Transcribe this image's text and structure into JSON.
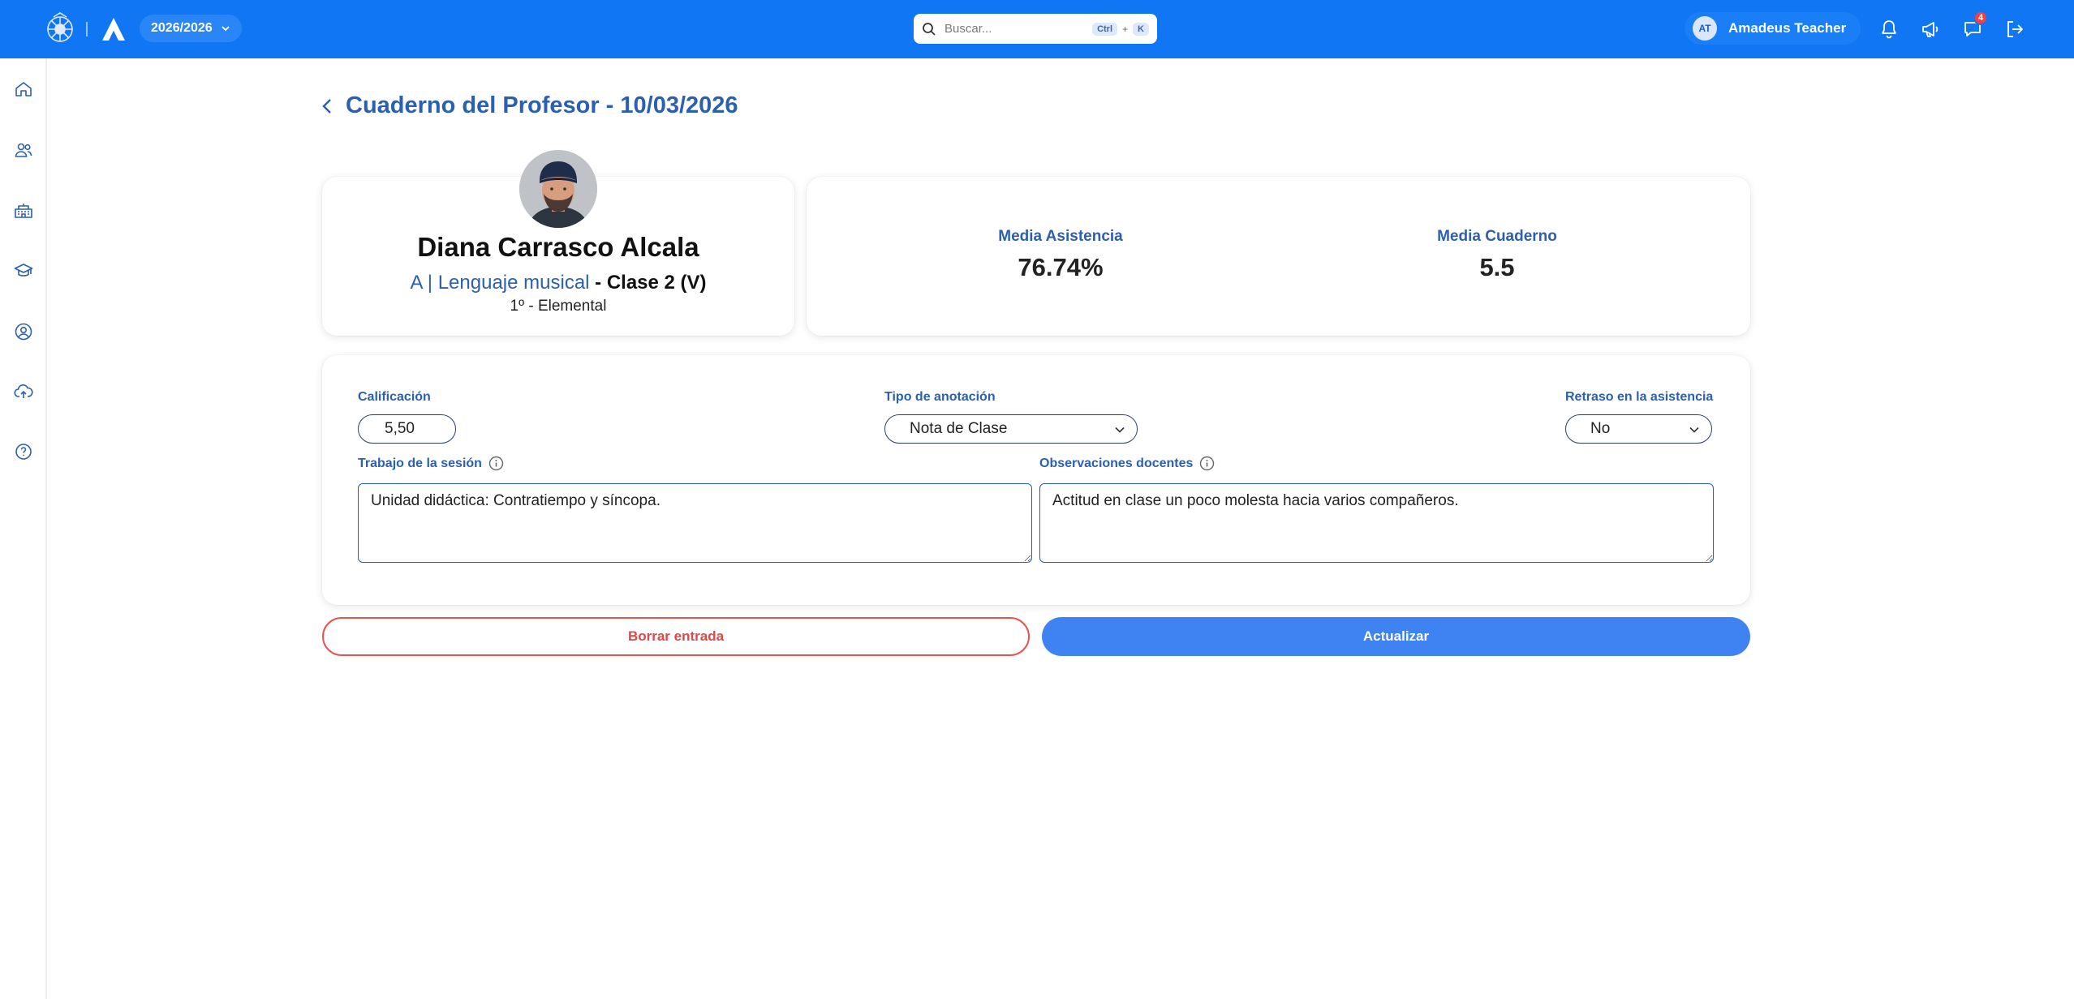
{
  "topbar": {
    "year": "2026/2026",
    "search": {
      "placeholder": "Buscar...",
      "kbd_ctrl": "Ctrl",
      "kbd_plus": "+",
      "kbd_k": "K"
    },
    "user": {
      "initials": "AT",
      "name": "Amadeus Teacher"
    },
    "messages_badge": "4",
    "icons": [
      "bell-icon",
      "megaphone-icon",
      "chat-icon",
      "logout-icon"
    ]
  },
  "sidebar": {
    "items": [
      {
        "icon": "home-icon"
      },
      {
        "icon": "users-icon"
      },
      {
        "icon": "school-icon"
      },
      {
        "icon": "graduation-cap-icon"
      },
      {
        "icon": "user-circle-icon"
      },
      {
        "icon": "cloud-upload-icon"
      },
      {
        "icon": "help-icon"
      }
    ]
  },
  "page": {
    "title": "Cuaderno del Profesor - 10/03/2026"
  },
  "student": {
    "name": "Diana Carrasco Alcala",
    "class_group": "A | Lenguaje musical",
    "class_session": " - Clase 2 (V)",
    "level": "1º - Elemental"
  },
  "stats": {
    "attendance_label": "Media Asistencia",
    "attendance_value": "76.74%",
    "notebook_label": "Media Cuaderno",
    "notebook_value": "5.5"
  },
  "form": {
    "grade_label": "Calificación",
    "grade_value": "5,50",
    "annotation_type_label": "Tipo de anotación",
    "annotation_type_value": "Nota de Clase",
    "delay_label": "Retraso en la asistencia",
    "delay_value": "No",
    "session_work_label": "Trabajo de la sesión",
    "session_work_value": "Unidad didáctica: Contratiempo y síncopa.",
    "observations_label": "Observaciones docentes",
    "observations_value": "Actitud en clase un poco molesta hacia varios compañeros."
  },
  "actions": {
    "delete_label": "Borrar entrada",
    "update_label": "Actualizar"
  },
  "colors": {
    "topbar": "#1076f4",
    "accent_text": "#2b5fb1",
    "danger": "#e24646",
    "primary_button": "#3f83f2"
  }
}
